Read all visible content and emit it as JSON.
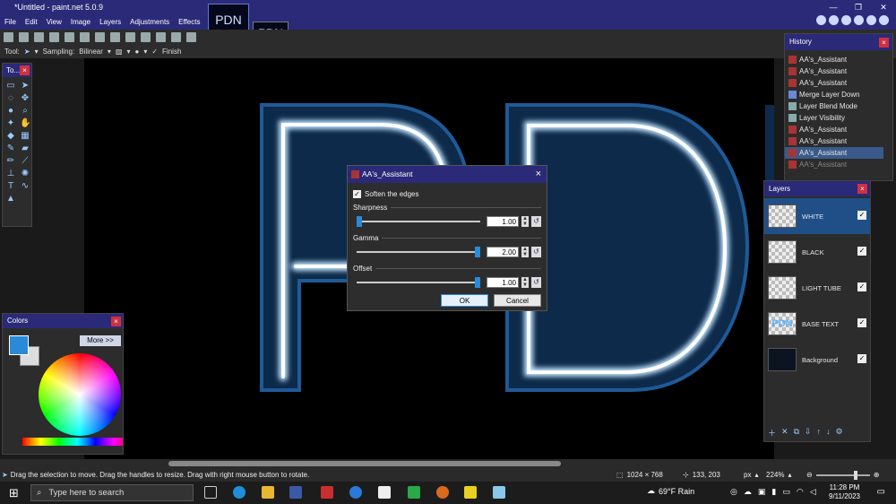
{
  "window": {
    "title": "*Untitled - paint.net 5.0.9"
  },
  "menu": [
    "File",
    "Edit",
    "View",
    "Image",
    "Layers",
    "Adjustments",
    "Effects"
  ],
  "image_tabs": [
    "PDN",
    "PDN"
  ],
  "toolbar2": {
    "tool_label": "Tool:",
    "sampling_label": "Sampling:",
    "sampling_value": "Bilinear",
    "finish_label": "Finish"
  },
  "tools_panel": {
    "title": "To..."
  },
  "colors_panel": {
    "title": "Colors",
    "more_label": "More >>"
  },
  "history_panel": {
    "title": "History",
    "items": [
      {
        "label": "AA's_Assistant"
      },
      {
        "label": "AA's_Assistant"
      },
      {
        "label": "AA's_Assistant"
      },
      {
        "label": "Merge Layer Down"
      },
      {
        "label": "Layer Blend Mode"
      },
      {
        "label": "Layer Visibility"
      },
      {
        "label": "AA's_Assistant"
      },
      {
        "label": "AA's_Assistant"
      },
      {
        "label": "AA's_Assistant"
      },
      {
        "label": "AA's_Assistant"
      }
    ]
  },
  "layers_panel": {
    "title": "Layers",
    "items": [
      {
        "name": "WHITE"
      },
      {
        "name": "BLACK"
      },
      {
        "name": "LIGHT TUBE"
      },
      {
        "name": "BASE TEXT"
      },
      {
        "name": "Background"
      }
    ],
    "base_text_thumb": "PDN"
  },
  "dialog": {
    "title": "AA's_Assistant",
    "checkbox_label": "Soften the edges",
    "sharpness": {
      "label": "Sharpness",
      "value": "1.00",
      "fraction": 0.0
    },
    "gamma": {
      "label": "Gamma",
      "value": "2.00",
      "fraction": 1.0
    },
    "offset": {
      "label": "Offset",
      "value": "1.00",
      "fraction": 1.0
    },
    "ok_label": "OK",
    "cancel_label": "Cancel"
  },
  "status": {
    "message": "Drag the selection to move. Drag the handles to resize. Drag with right mouse button to rotate.",
    "size": "1024 × 768",
    "coords": "133, 203",
    "unit": "px",
    "zoom": "224%"
  },
  "taskbar": {
    "search_placeholder": "Type here to search",
    "weather": "69°F  Rain",
    "time": "11:28 PM",
    "date": "9/11/2023"
  },
  "colors": {
    "accent": "#2a8ad8",
    "titlebar": "#2a2a78",
    "close": "#d03040",
    "glow": "#2f7fcf"
  }
}
